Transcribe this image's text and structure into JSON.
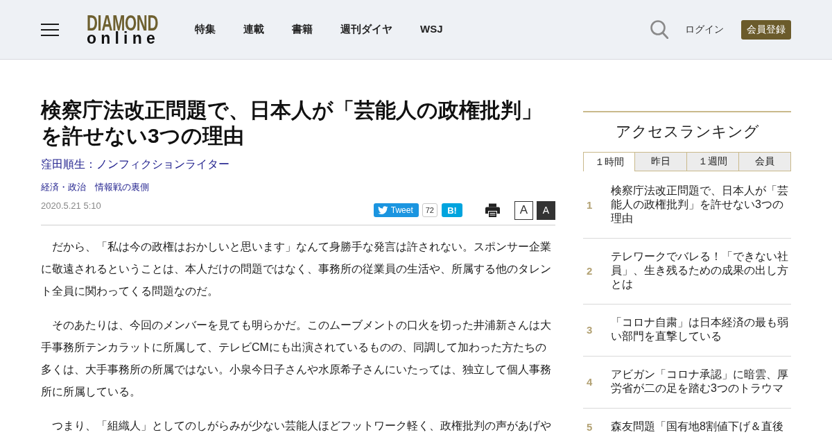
{
  "header": {
    "logo": {
      "wordmark": "DIAMOND",
      "subline": "online"
    },
    "nav": [
      "特集",
      "連載",
      "書籍",
      "週刊ダイヤ",
      "WSJ"
    ],
    "login": "ログイン",
    "register": "会員登録"
  },
  "article": {
    "title": "検察庁法改正問題で、日本人が「芸能人の政権批判」を許せない3つの理由",
    "author": "窪田順生：ノンフィクションライター",
    "tags": [
      "経済・政治",
      "情報戦の裏側"
    ],
    "date": "2020.5.21 5:10",
    "share": {
      "tweet": "Tweet",
      "tweet_count": "72",
      "hatena": "B!"
    },
    "text_size": [
      {
        "label": "A",
        "selected": false
      },
      {
        "label": "A",
        "selected": true
      }
    ],
    "paragraphs": [
      "だから、「私は今の政権はおかしいと思います」なんて身勝手な発言は許されない。スポンサー企業に敬遠されるということは、本人だけの問題ではなく、事務所の従業員の生活や、所属する他のタレント全員に関わってくる問題なのだ。",
      "そのあたりは、今回のメンバーを見ても明らかだ。このムーブメントの口火を切った井浦新さんは大手事務所テンカラットに所属して、テレビCMにも出演されているものの、同調して加わった方たちの多くは、大手事務所の所属ではない。小泉今日子さんや水原希子さんにいたっては、独立して個人事務所に所属している。",
      "つまり、「組織人」としてのしがらみが少ない芸能人ほどフットワーク軽く、政権批判の声があげや"
    ]
  },
  "ranking": {
    "title": "アクセスランキング",
    "tabs": [
      {
        "label": "１時間",
        "selected": true
      },
      {
        "label": "昨日",
        "selected": false
      },
      {
        "label": "１週間",
        "selected": false
      },
      {
        "label": "会員",
        "selected": false
      }
    ],
    "items": [
      {
        "rank": "1",
        "title": "検察庁法改正問題で、日本人が「芸能人の政権批判」を許せない3つの理由"
      },
      {
        "rank": "2",
        "title": "テレワークでバレる！「できない社員」、生き残るための成果の出し方とは"
      },
      {
        "rank": "3",
        "title": "「コロナ自粛」は日本経済の最も弱い部門を直撃している"
      },
      {
        "rank": "4",
        "title": "アビガン「コロナ承認」に暗雲、厚労省が二の足を踏む3つのトラウマ"
      },
      {
        "rank": "5",
        "title": "森友問題「国有地8割値下げ＆直後"
      }
    ]
  }
}
